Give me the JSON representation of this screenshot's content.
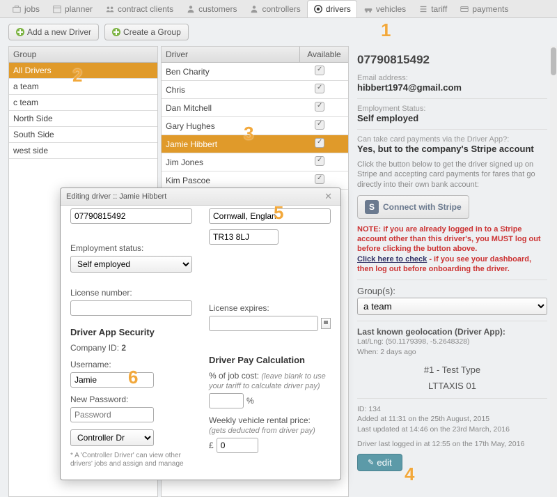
{
  "nav": {
    "tabs": [
      {
        "label": "jobs",
        "icon": "briefcase-icon"
      },
      {
        "label": "planner",
        "icon": "calendar-icon"
      },
      {
        "label": "contract clients",
        "icon": "users-icon"
      },
      {
        "label": "customers",
        "icon": "customers-icon"
      },
      {
        "label": "controllers",
        "icon": "controller-icon"
      },
      {
        "label": "drivers",
        "icon": "steering-icon",
        "active": true
      },
      {
        "label": "vehicles",
        "icon": "car-icon"
      },
      {
        "label": "tariff",
        "icon": "list-icon"
      },
      {
        "label": "payments",
        "icon": "card-icon"
      }
    ]
  },
  "toolbar": {
    "add_driver": "Add a new Driver",
    "create_group": "Create a Group"
  },
  "group_col": {
    "header": "Group",
    "items": [
      "All Drivers",
      "a team",
      "c team",
      "North Side",
      "South Side",
      "west side"
    ],
    "selected": 0
  },
  "driver_col": {
    "header": "Driver",
    "avail_header": "Available",
    "items": [
      {
        "name": "Ben Charity",
        "available": true
      },
      {
        "name": "Chris",
        "available": true
      },
      {
        "name": "Dan Mitchell",
        "available": true
      },
      {
        "name": "Gary Hughes",
        "available": true
      },
      {
        "name": "Jamie Hibbert",
        "available": true,
        "selected": true
      },
      {
        "name": "Jim Jones",
        "available": true
      },
      {
        "name": "Kim Pascoe",
        "available": true
      }
    ]
  },
  "details": {
    "phone": "07790815492",
    "email_label": "Email address:",
    "email": "hibbert1974@gmail.com",
    "emp_status_label": "Employment Status:",
    "emp_status": "Self employed",
    "card_q": "Can take card payments via the Driver App?:",
    "card_a": "Yes, but to the company's Stripe account",
    "stripe_intro": "Click the button below to get the driver signed up on Stripe and accepting card payments for fares that go directly into their own bank account:",
    "stripe_btn": "Connect with Stripe",
    "warn_line1": "NOTE: if you are already logged in to a Stripe account other than this driver's, you MUST log out before clicking the button above.",
    "warn_link": "Click here to check",
    "warn_line2": " - if you see your dashboard, then log out before onboarding the driver.",
    "groups_label": "Group(s):",
    "groups_value": "a team",
    "geo_label": "Last known geolocation (Driver App):",
    "geo_value": "Lat/Lng: (50.1179398, -5.2648328)",
    "geo_when": "When: 2 days ago",
    "type_line1": "#1 - Test Type",
    "type_line2": "LTTAXIS 01",
    "id_line": "ID: 134",
    "added": "Added at 11:31 on the 25th August, 2015",
    "updated": "Last updated at 14:46 on the 23rd March, 2016",
    "lastlogin": "Driver last logged in at 12:55 on the 17th May, 2016",
    "edit_btn": "edit"
  },
  "modal": {
    "title": "Editing driver :: Jamie Hibbert",
    "phone_value": "07790815492",
    "addr1": "Cornwall, Englan",
    "addr2": "TR13 8LJ",
    "emp_status_label": "Employment status:",
    "emp_status_value": "Self employed",
    "license_label": "License number:",
    "license_exp_label": "License expires:",
    "sec_title": "Driver App Security",
    "company_id_label": "Company ID:",
    "company_id_value": "2",
    "username_label": "Username:",
    "username_value": "Jamie",
    "newpass_label": "New Password:",
    "newpass_placeholder": "Password",
    "role_value": "Controller Dr",
    "footnote": "* A 'Controller Driver' can view other drivers' jobs and assign and manage",
    "pay_title": "Driver Pay Calculation",
    "pct_label": "% of job cost:",
    "pct_hint": "(leave blank to use your tariff to calculate driver pay)",
    "pct_unit": "%",
    "rental_label": "Weekly vehicle rental price:",
    "rental_hint": "(gets deducted from driver pay)",
    "rental_unit": "£",
    "rental_value": "0"
  },
  "annotations": {
    "1": "1",
    "2": "2",
    "3": "3",
    "4": "4",
    "5": "5",
    "6": "6"
  }
}
